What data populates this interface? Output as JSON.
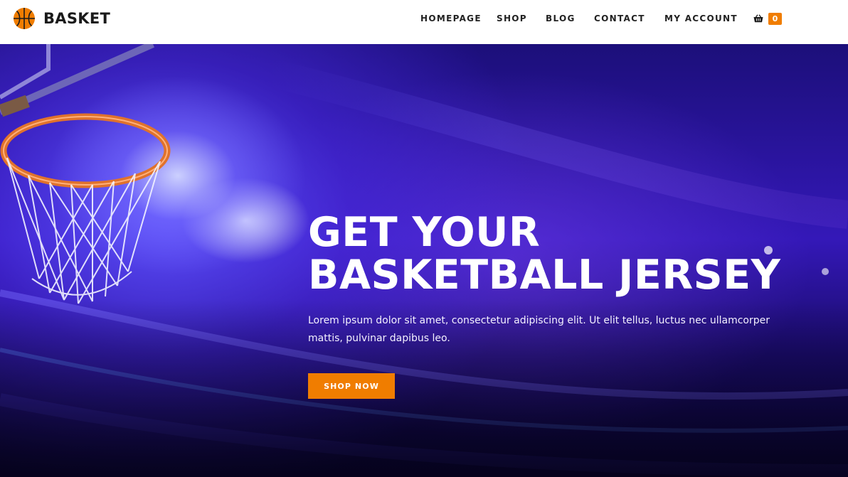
{
  "brand": {
    "name": "BASKET",
    "logo_icon": "basketball-icon"
  },
  "nav": {
    "items": [
      {
        "label": "HOMEPAGE"
      },
      {
        "label": "SHOP"
      },
      {
        "label": "BLOG"
      },
      {
        "label": "CONTACT"
      },
      {
        "label": "MY ACCOUNT"
      }
    ],
    "cart": {
      "icon": "basket-icon",
      "count": "0"
    }
  },
  "hero": {
    "title_line1": "GET YOUR",
    "title_line2": "BASKETBALL JERSEY",
    "text": "Lorem ipsum dolor sit amet, consectetur adipiscing elit. Ut elit tellus, luctus nec ullamcorper mattis, pulvinar dapibus leo.",
    "button_label": "SHOP NOW"
  },
  "colors": {
    "accent": "#f07d00",
    "header_bg": "#ffffff",
    "hero_text": "#ffffff"
  }
}
